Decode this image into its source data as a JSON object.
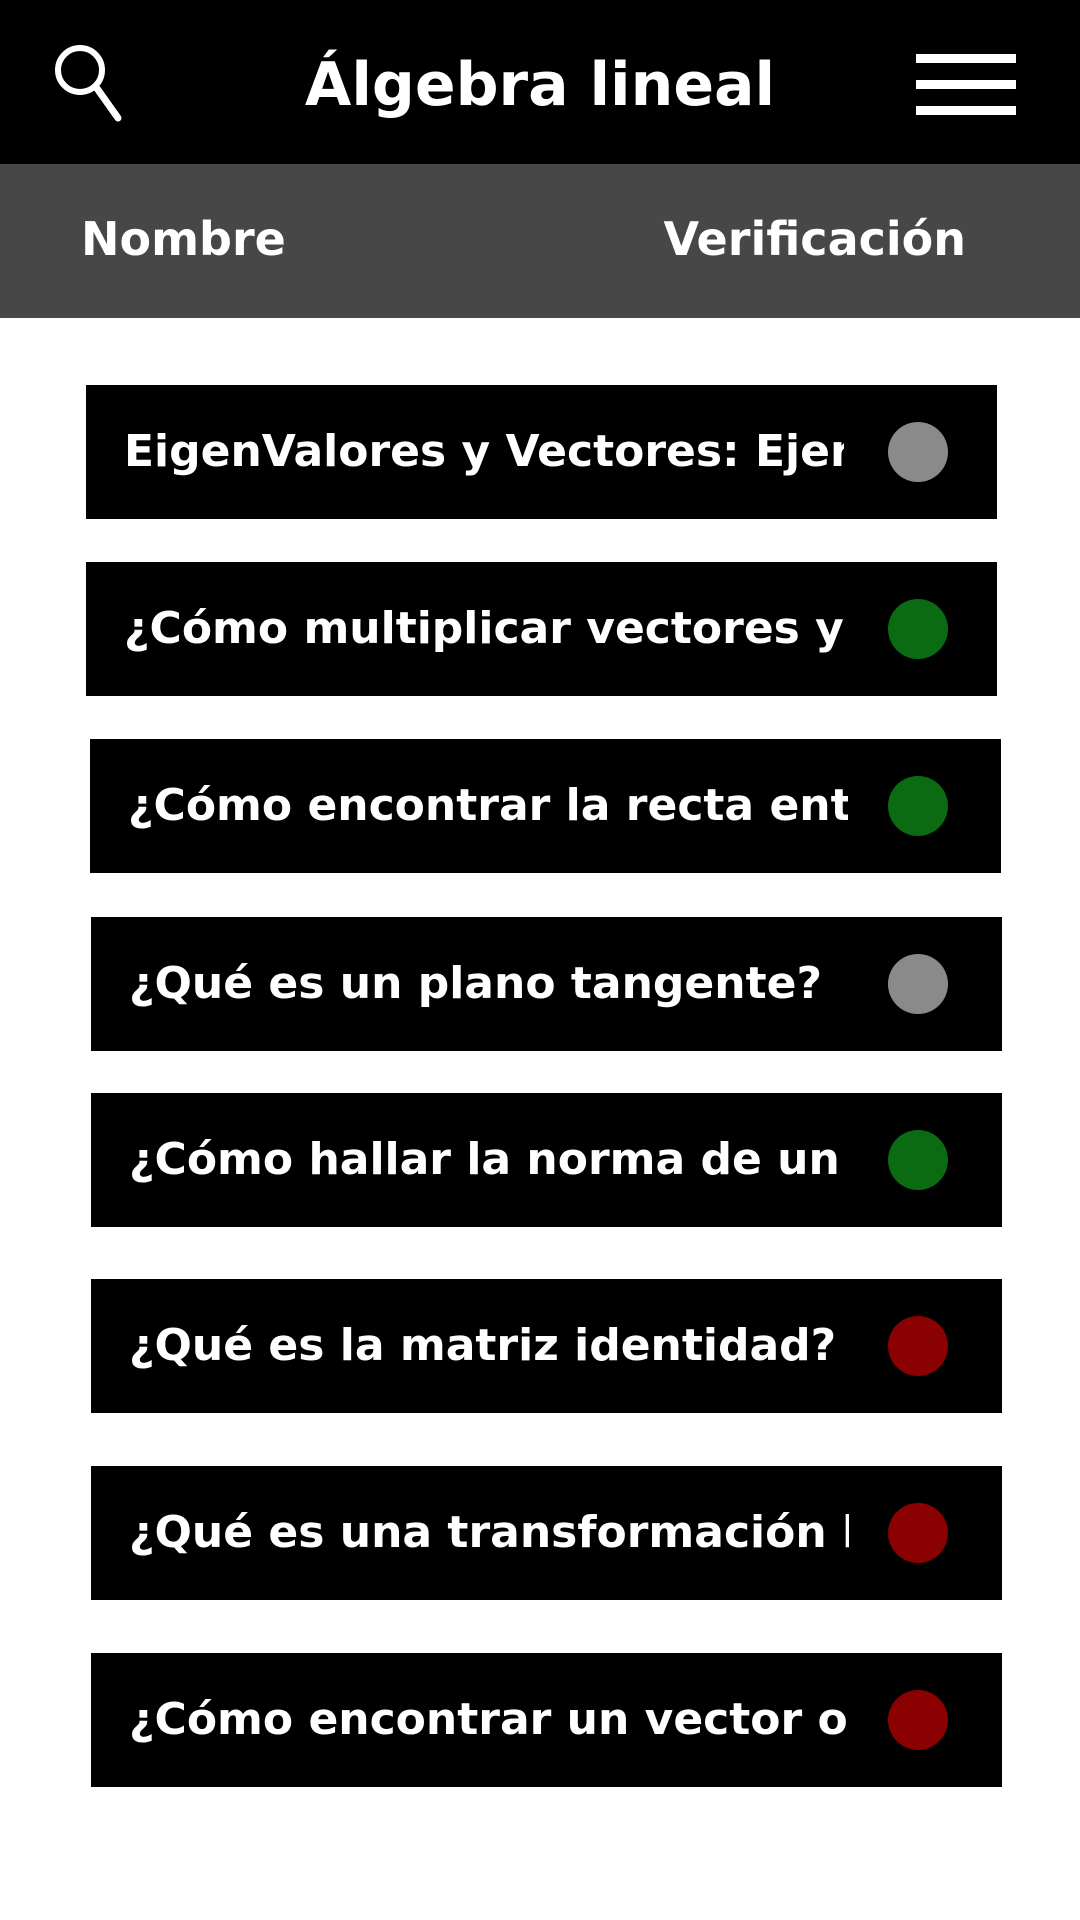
{
  "header": {
    "title": "Álgebra lineal",
    "search_icon": "search-icon",
    "menu_icon": "hamburger-menu-icon"
  },
  "columns": {
    "name": "Nombre",
    "verification": "Verificación"
  },
  "colors": {
    "pending": "#8a8a8a",
    "verified": "#0a6b12",
    "failed": "#8b0000"
  },
  "items": [
    {
      "label": "EigenValores y Vectores: Ejerci...",
      "status": "pending"
    },
    {
      "label": "¿Cómo multiplicar vectores y m...",
      "status": "verified"
    },
    {
      "label": "¿Cómo encontrar la recta entre ...",
      "status": "verified"
    },
    {
      "label": "¿Qué es un plano tangente?",
      "status": "pending"
    },
    {
      "label": "¿Cómo hallar la norma de un ve...",
      "status": "verified"
    },
    {
      "label": "¿Qué es la matriz identidad?",
      "status": "failed"
    },
    {
      "label": "¿Qué es una transformación lin...",
      "status": "failed"
    },
    {
      "label": "¿Cómo encontrar un vector ort...",
      "status": "failed"
    }
  ]
}
